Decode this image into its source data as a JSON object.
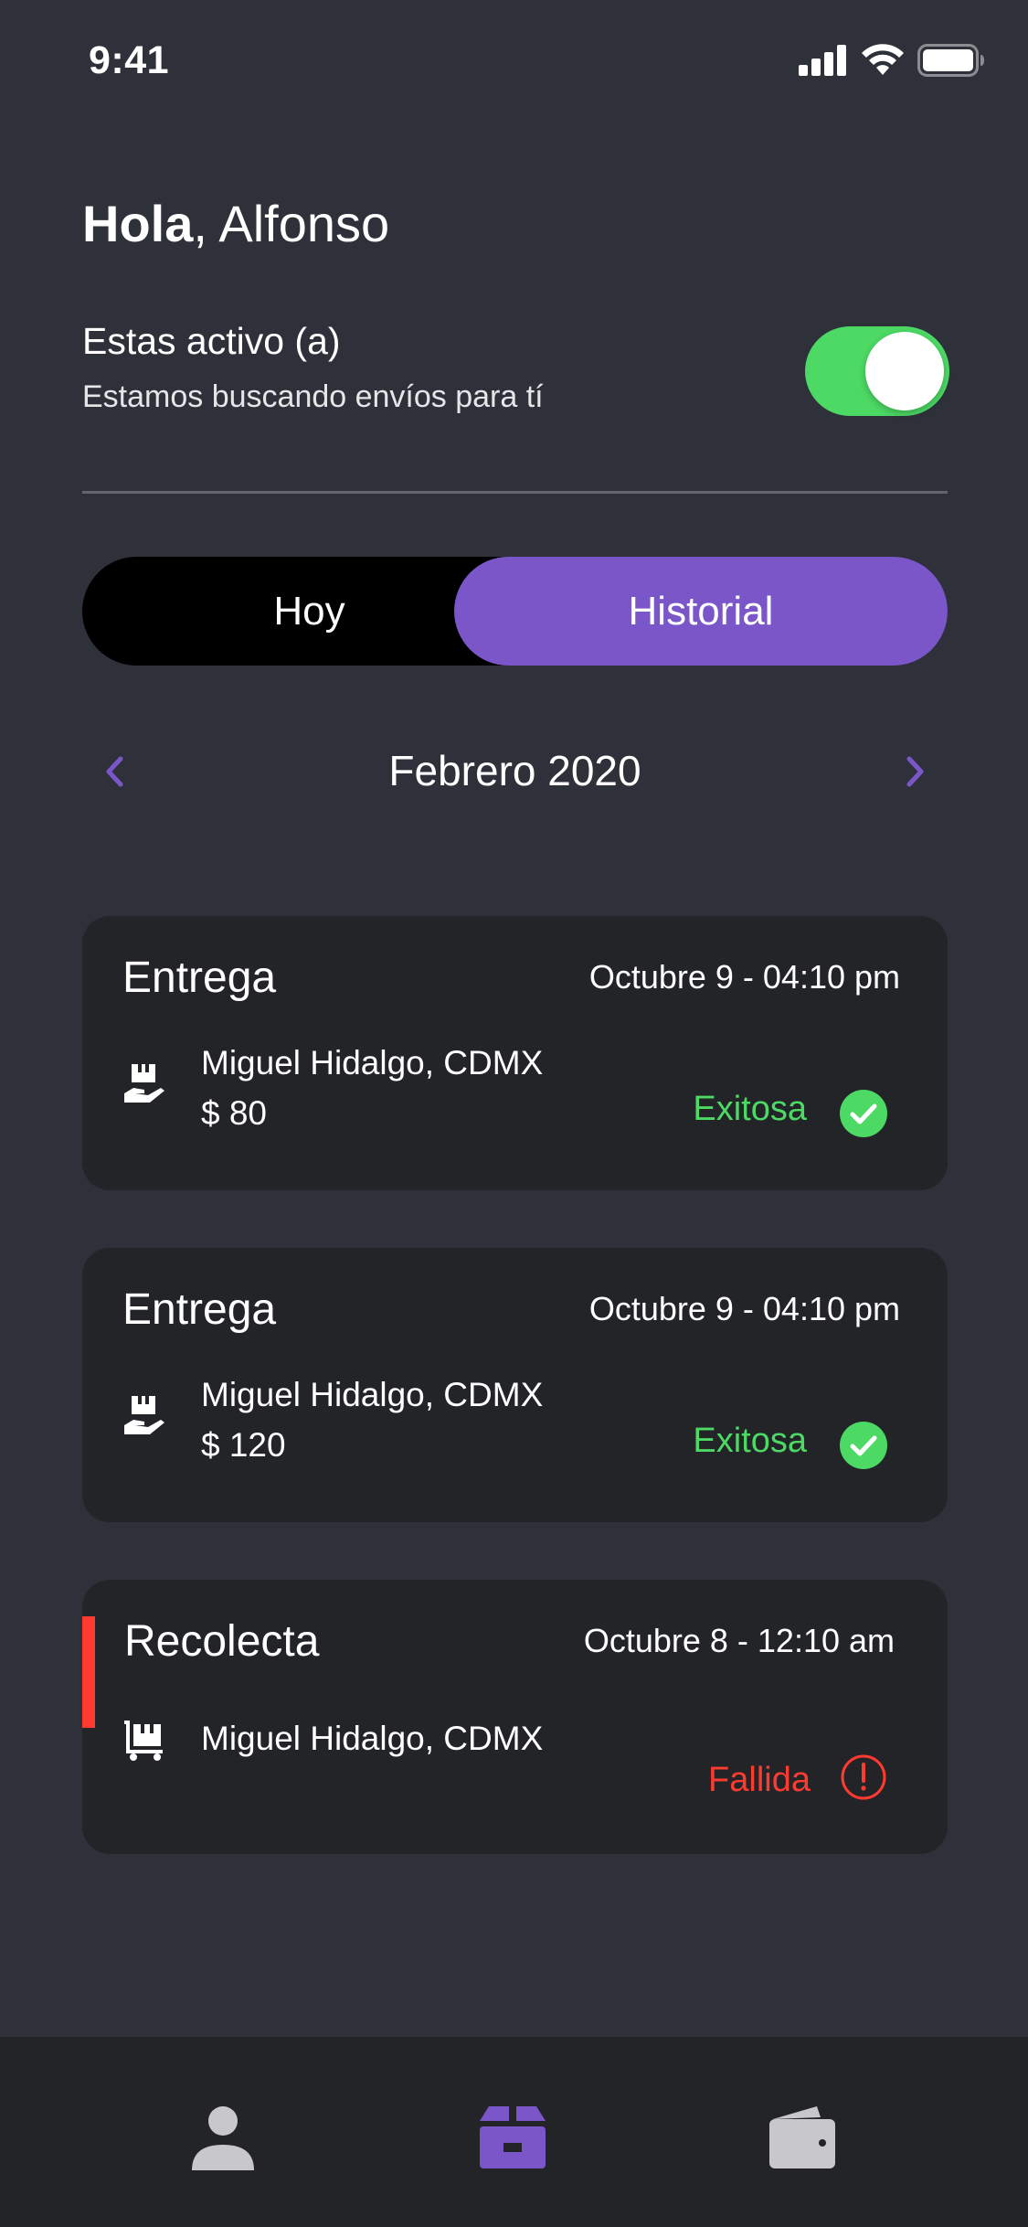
{
  "status_bar": {
    "time": "9:41"
  },
  "header": {
    "greeting_bold": "Hola",
    "greeting_rest": ", Alfonso"
  },
  "availability": {
    "title": "Estas activo (a)",
    "subtitle": "Estamos buscando envíos para tí",
    "toggle_on": true
  },
  "segments": {
    "today_label": "Hoy",
    "history_label": "Historial",
    "selected": "Historial"
  },
  "month_nav": {
    "label": "Febrero 2020",
    "prev_icon": "chevron-left-icon",
    "next_icon": "chevron-right-icon"
  },
  "shipments": [
    {
      "type": "Entrega",
      "datetime": "Octubre 9 - 04:10 pm",
      "address": "Miguel Hidalgo, CDMX",
      "price": "$ 80",
      "status": "Exitosa",
      "icon": "hand-package-icon"
    },
    {
      "type": "Entrega",
      "datetime": "Octubre 9 - 04:10 pm",
      "address": "Miguel Hidalgo, CDMX",
      "price": "$ 120",
      "status": "Exitosa",
      "icon": "hand-package-icon"
    },
    {
      "type": "Recolecta",
      "datetime": "Octubre 8 - 12:10 am",
      "address": "Miguel Hidalgo, CDMX",
      "price": "",
      "status": "Fallida",
      "icon": "cart-package-icon"
    }
  ],
  "tab_bar": {
    "items": [
      {
        "icon": "person-icon",
        "active": false
      },
      {
        "icon": "package-icon",
        "active": true
      },
      {
        "icon": "wallet-icon",
        "active": false
      }
    ]
  },
  "colors": {
    "background": "#2e313a",
    "card": "#222428",
    "accent": "#7a56c8",
    "success": "#4cd964",
    "error": "#ff3b30",
    "inactive_icon": "#c7c7cc"
  }
}
